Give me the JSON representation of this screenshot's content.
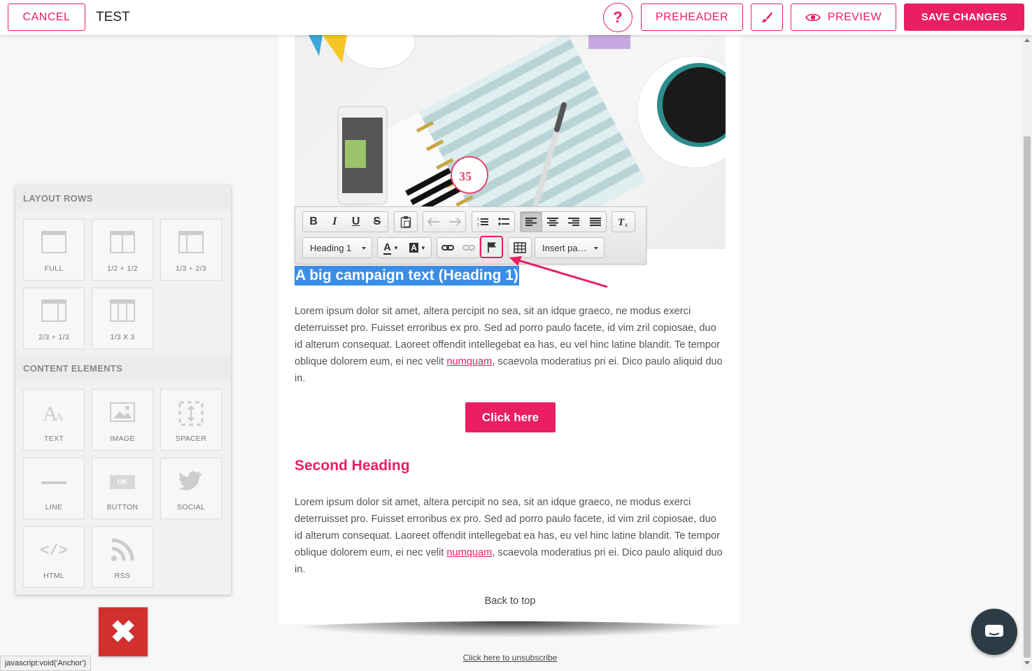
{
  "topbar": {
    "cancel_label": "CANCEL",
    "title": "TEST",
    "help_label": "?",
    "preheader_label": "PREHEADER",
    "preview_label": "PREVIEW",
    "save_label": "SAVE CHANGES"
  },
  "toolbar": {
    "bold": "B",
    "italic": "I",
    "underline": "U",
    "strike": "S",
    "format_select": "Heading 1",
    "font_color": "A",
    "bg_color": "A",
    "placeholder_select": "Insert pa…"
  },
  "email": {
    "heading1": "A big campaign text (Heading 1)",
    "p1_before": "Lorem ipsum dolor sit amet, altera percipit no sea, sit an idque graeco, ne modus exerci deterruisset pro. Fuisset erroribus ex pro. Sed ad porro paulo facete, id vim zril copiosae, duo id alterum consequat. Laoreet offendit intellegebat ea has, eu vel hinc latine blandit. Te tempor oblique dolorem eum, ei nec velit ",
    "link": "numquam",
    "p1_after": ", scaevola moderatius pri ei. Dico paulo aliquid duo in.",
    "cta_label": "Click here",
    "heading2": "Second Heading",
    "back_to_top": "Back to top",
    "unsubscribe": "Click here to unsubscribe"
  },
  "panel": {
    "layout_title": "LAYOUT ROWS",
    "layout_items": [
      "FULL",
      "1/2 + 1/2",
      "1/3 + 2/3",
      "2/3 + 1/3",
      "1/3 X 3"
    ],
    "content_title": "CONTENT ELEMENTS",
    "content_items": [
      "TEXT",
      "IMAGE",
      "SPACER",
      "LINE",
      "BUTTON",
      "SOCIAL",
      "HTML",
      "RSS"
    ],
    "button_icon_text": "OK",
    "html_icon_text": "</>"
  },
  "status_text": "javascript:void('Anchor')",
  "colors": {
    "accent": "#e91e63",
    "selection": "#3a8ee6",
    "close": "#d32f2f",
    "chat": "#2d3b45"
  }
}
